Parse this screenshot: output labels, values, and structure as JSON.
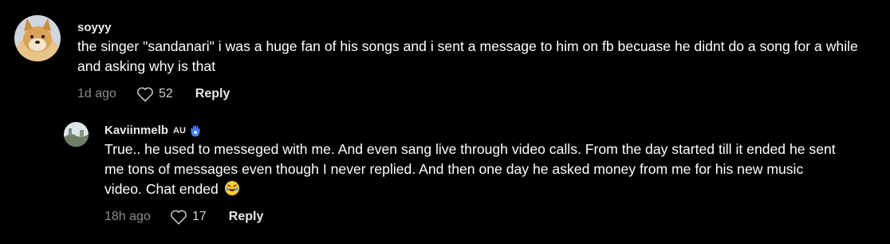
{
  "comment": {
    "username": "soyyy",
    "text": "the singer \"sandanari\" i was a huge fan of his songs and i sent a message to him on fb becuase he didnt do a song for a while and asking why is that",
    "time": "1d ago",
    "likes": "52",
    "reply_label": "Reply",
    "avatar_icon": "shiba-dog-avatar"
  },
  "reply": {
    "username": "Kaviinmelb",
    "region": "AU",
    "badge_icon": "hamsa-icon",
    "text": "True.. he used to messeged with me. And even sang live through video calls. From the day started till it ended he sent me tons of messages even though I never replied. And then one day he asked money from me for his new music video. Chat ended",
    "emoji_icon": "rolling-laughing-emoji",
    "time": "18h ago",
    "likes": "17",
    "reply_label": "Reply",
    "avatar_icon": "landscape-avatar"
  },
  "colors": {
    "background": "#000000",
    "text": "#ffffff",
    "muted": "#8a8a8a",
    "badge": "#4a7dff"
  }
}
